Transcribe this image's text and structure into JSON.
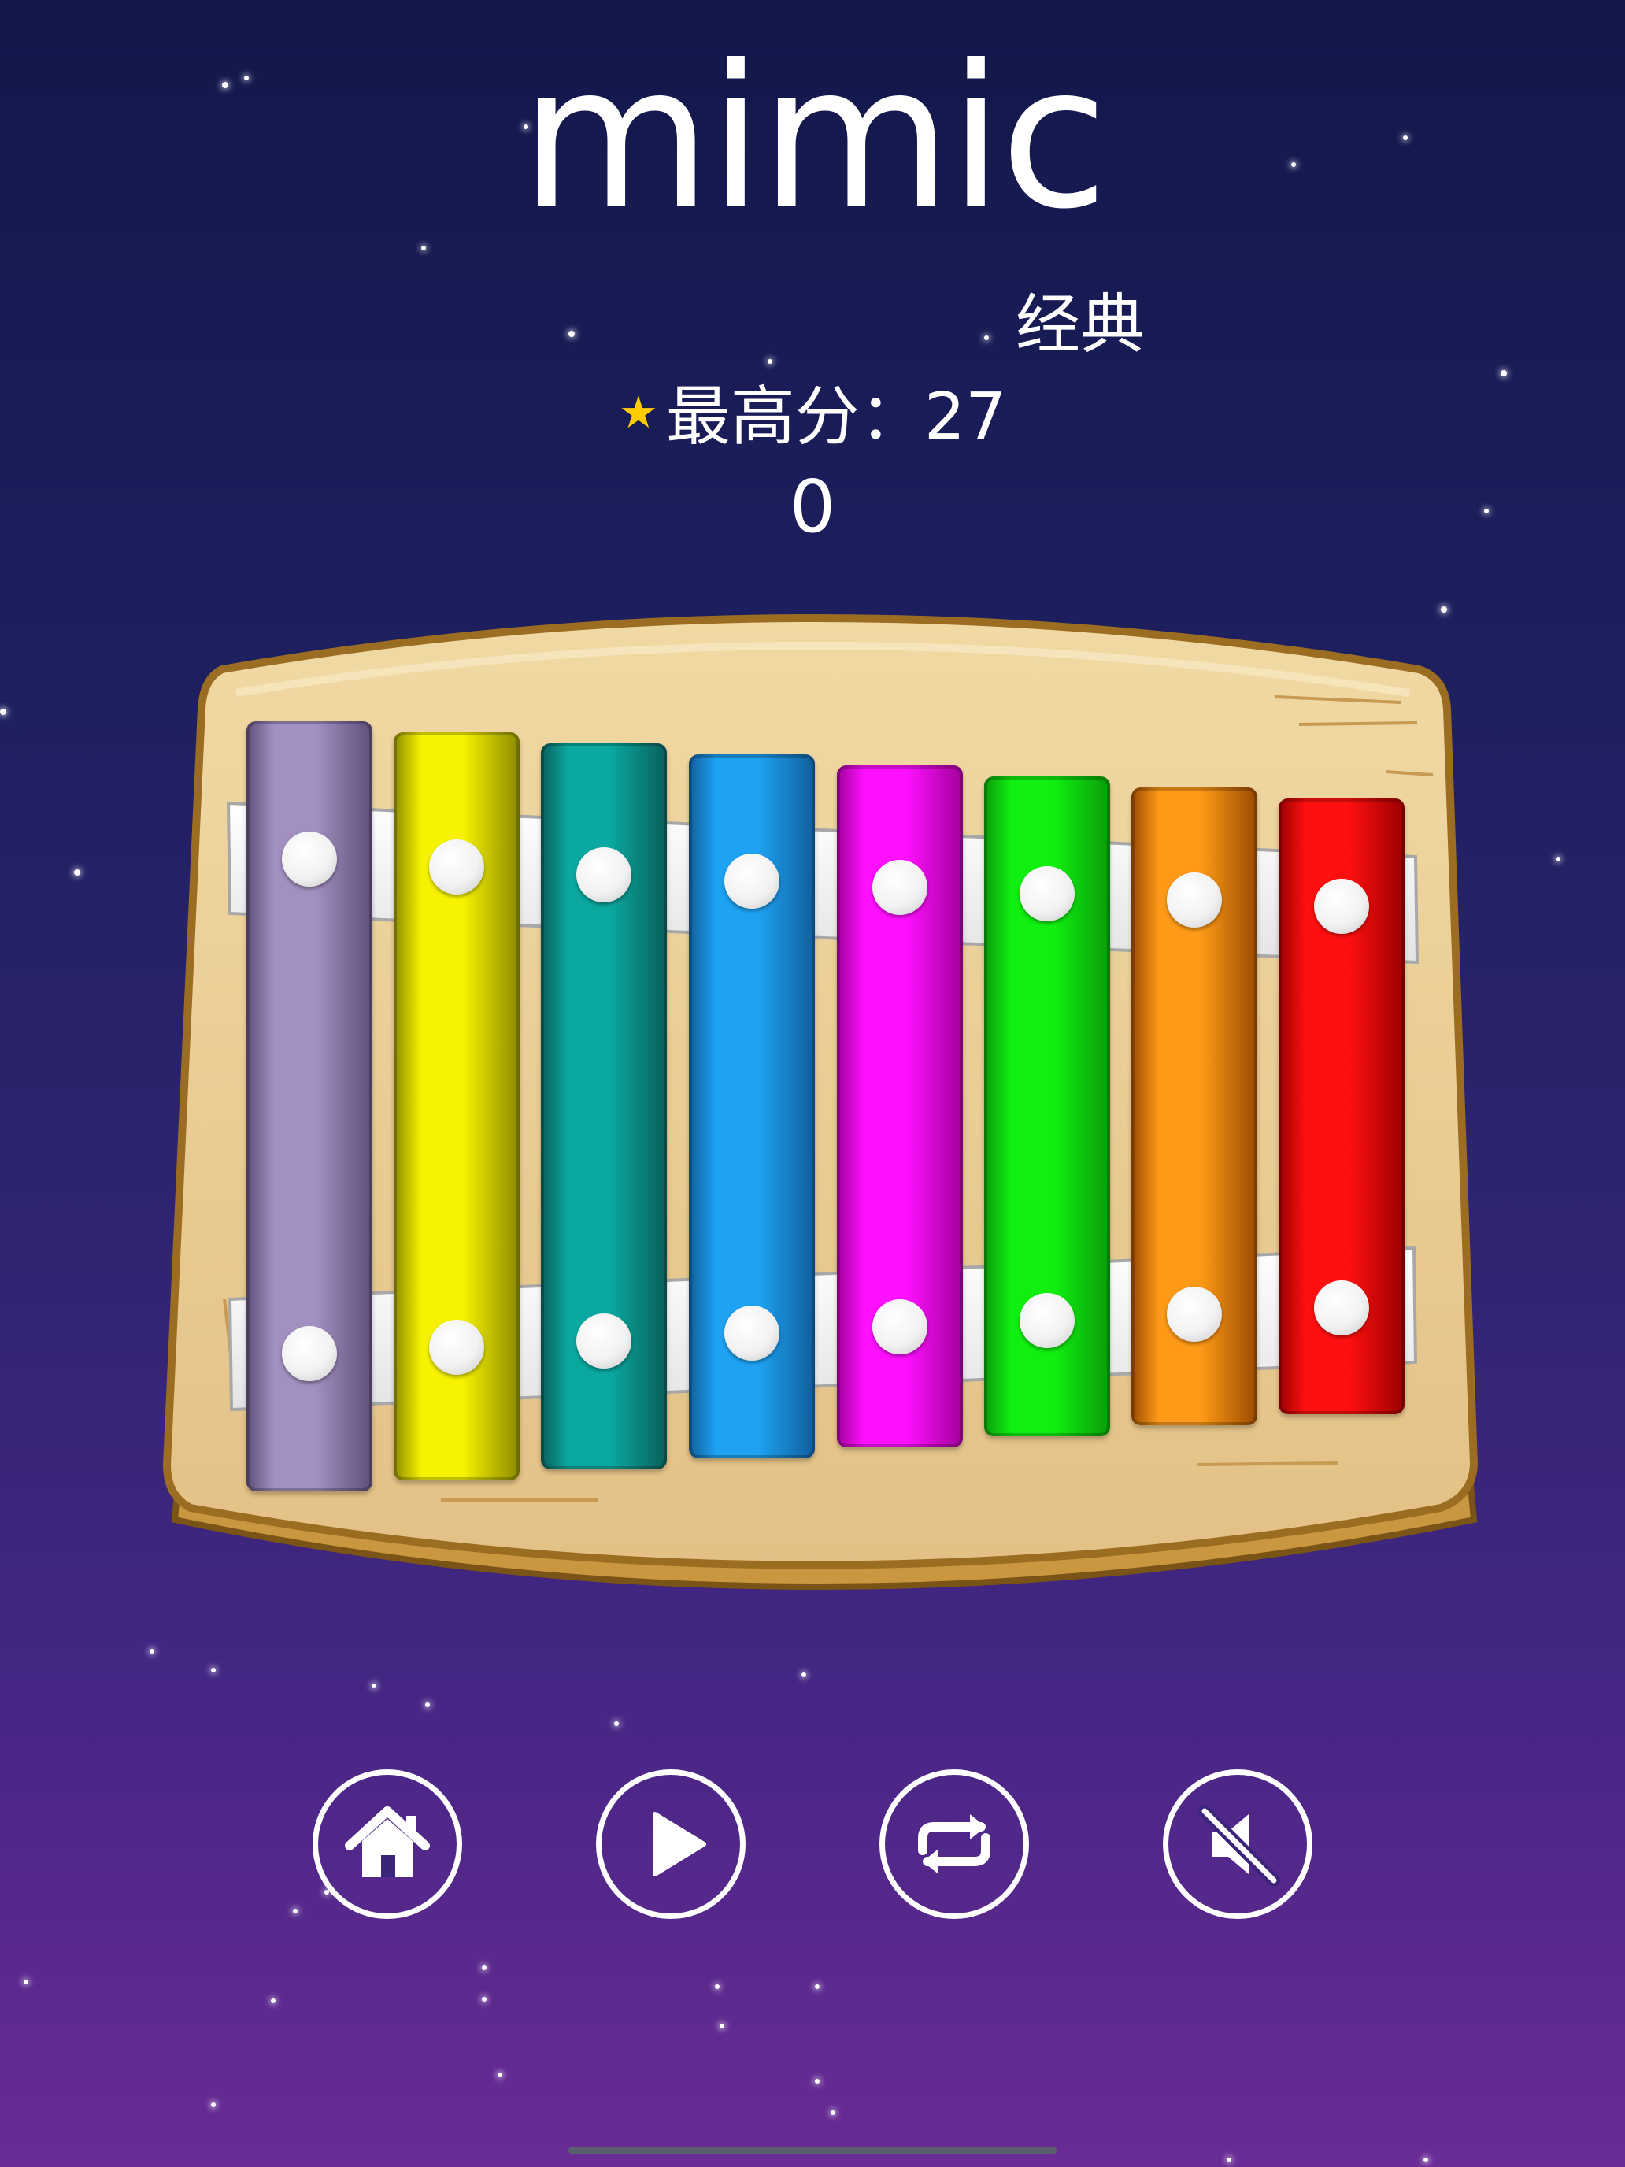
{
  "app": {
    "title": "mimic",
    "mode_label": "经典",
    "best_label": "最高分：27",
    "current_score": "0"
  },
  "xylophone": {
    "bars": [
      {
        "color_top": "#a290c0",
        "color_side": "#5e4e7a",
        "name": "bar-purple"
      },
      {
        "color_top": "#f6f200",
        "color_side": "#8c8a00",
        "name": "bar-yellow"
      },
      {
        "color_top": "#0aa8a0",
        "color_side": "#0a5e5a",
        "name": "bar-teal"
      },
      {
        "color_top": "#1ea2f2",
        "color_side": "#115d9b",
        "name": "bar-blue"
      },
      {
        "color_top": "#ff10ff",
        "color_side": "#a0009a",
        "name": "bar-magenta"
      },
      {
        "color_top": "#10f010",
        "color_side": "#0a9a0a",
        "name": "bar-green"
      },
      {
        "color_top": "#ff9a18",
        "color_side": "#9a4a00",
        "name": "bar-orange"
      },
      {
        "color_top": "#ff1010",
        "color_side": "#9a0000",
        "name": "bar-red"
      }
    ]
  },
  "controls": [
    {
      "name": "home-button",
      "icon": "home-icon"
    },
    {
      "name": "play-button",
      "icon": "play-icon"
    },
    {
      "name": "repeat-button",
      "icon": "repeat-icon"
    },
    {
      "name": "mute-button",
      "icon": "speaker-muted-icon"
    }
  ],
  "colors": {
    "background_top": "#13184a",
    "background_bottom": "#6a2b95",
    "wood": "#e6c98e",
    "wood_edge": "#b98b3a",
    "star_accent": "#ffcc00"
  }
}
